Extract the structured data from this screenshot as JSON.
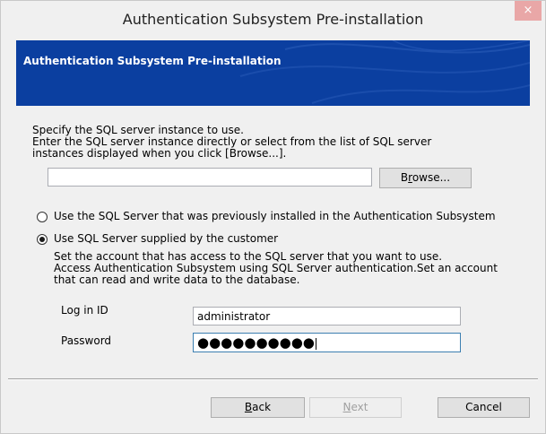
{
  "window": {
    "title": "Authentication Subsystem Pre-installation",
    "close_glyph": "×"
  },
  "banner": {
    "title": "Authentication Subsystem Pre-installation",
    "color": "#0b3fa0"
  },
  "instructions": {
    "line1": "Specify the SQL server instance to use.",
    "line2": "Enter the SQL server instance directly or select from the list of SQL server",
    "line3": "instances displayed when you click [Browse...]."
  },
  "instance_input": {
    "value": ""
  },
  "browse_button": {
    "prefix": "B",
    "underlined": "r",
    "suffix": "owse..."
  },
  "options": {
    "previous": {
      "label": "Use the SQL Server that was previously installed in the Authentication Subsystem",
      "selected": false
    },
    "customer": {
      "label": "Use SQL Server supplied by the customer",
      "selected": true,
      "desc_line1": "Set the account that has access to the SQL server that you want to use.",
      "desc_line2": "Access Authentication Subsystem using SQL Server authentication.Set an account",
      "desc_line3": "that can read and write data to the database."
    }
  },
  "login": {
    "label": "Log in ID",
    "value": "administrator"
  },
  "password": {
    "label": "Password",
    "masked_value": "●●●●●●●●●●"
  },
  "footer": {
    "back_underlined": "B",
    "back_rest": "ack",
    "next_underlined": "N",
    "next_rest": "ext",
    "cancel": "Cancel"
  }
}
